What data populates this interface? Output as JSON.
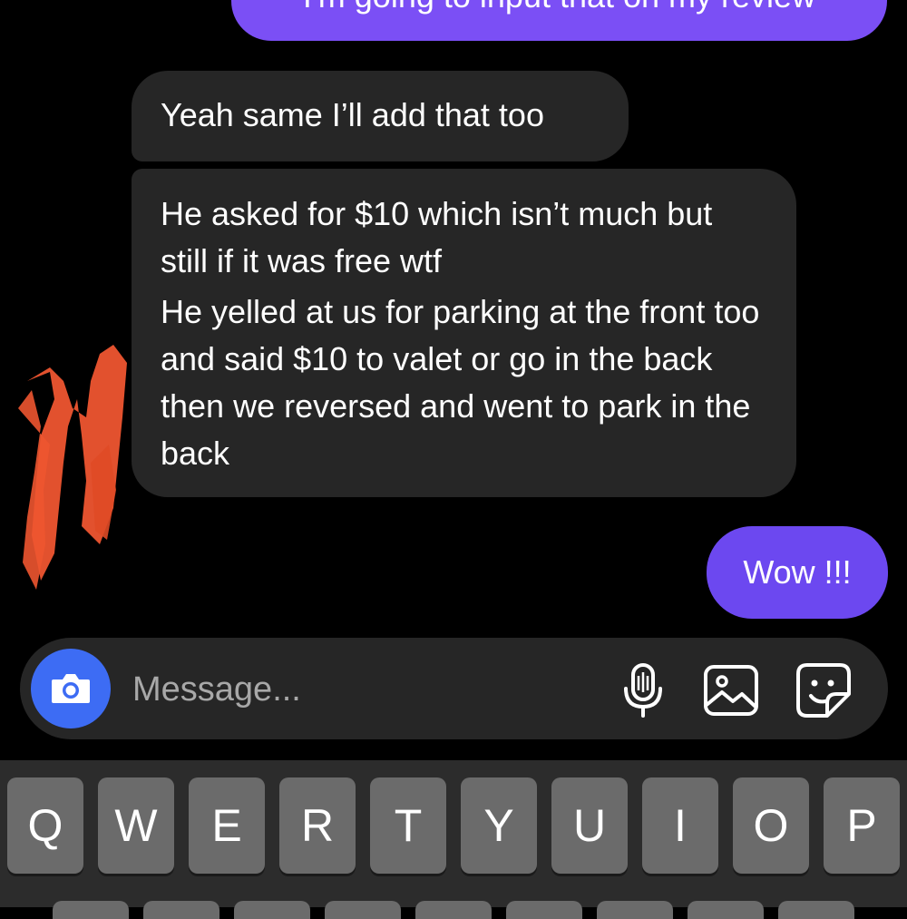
{
  "messages": [
    {
      "id": "sent-top",
      "direction": "outgoing",
      "text": "I'm going to input that on my review"
    },
    {
      "id": "recv-1",
      "direction": "incoming",
      "text": "Yeah same I’ll add that too"
    },
    {
      "id": "recv-2",
      "direction": "incoming",
      "lines": [
        "He asked for $10 which isn’t much but still if it was free wtf",
        "He yelled at us for parking at the front too and said $10 to valet or go in the back then we reversed and went to park in the back"
      ]
    },
    {
      "id": "sent-wow",
      "direction": "outgoing",
      "text": "Wow !!!"
    }
  ],
  "composer": {
    "placeholder": "Message...",
    "icons": [
      "camera-icon",
      "microphone-icon",
      "gallery-icon",
      "sticker-icon"
    ]
  },
  "keyboard": {
    "row1": [
      "Q",
      "W",
      "E",
      "R",
      "T",
      "Y",
      "U",
      "I",
      "O",
      "P"
    ]
  },
  "colors": {
    "background": "#000000",
    "incoming_bubble": "#262626",
    "outgoing_bubble": "#7b4ff5",
    "camera_button": "#3d6cf4",
    "key": "#6b6b6b",
    "redaction": "#ee5530"
  }
}
